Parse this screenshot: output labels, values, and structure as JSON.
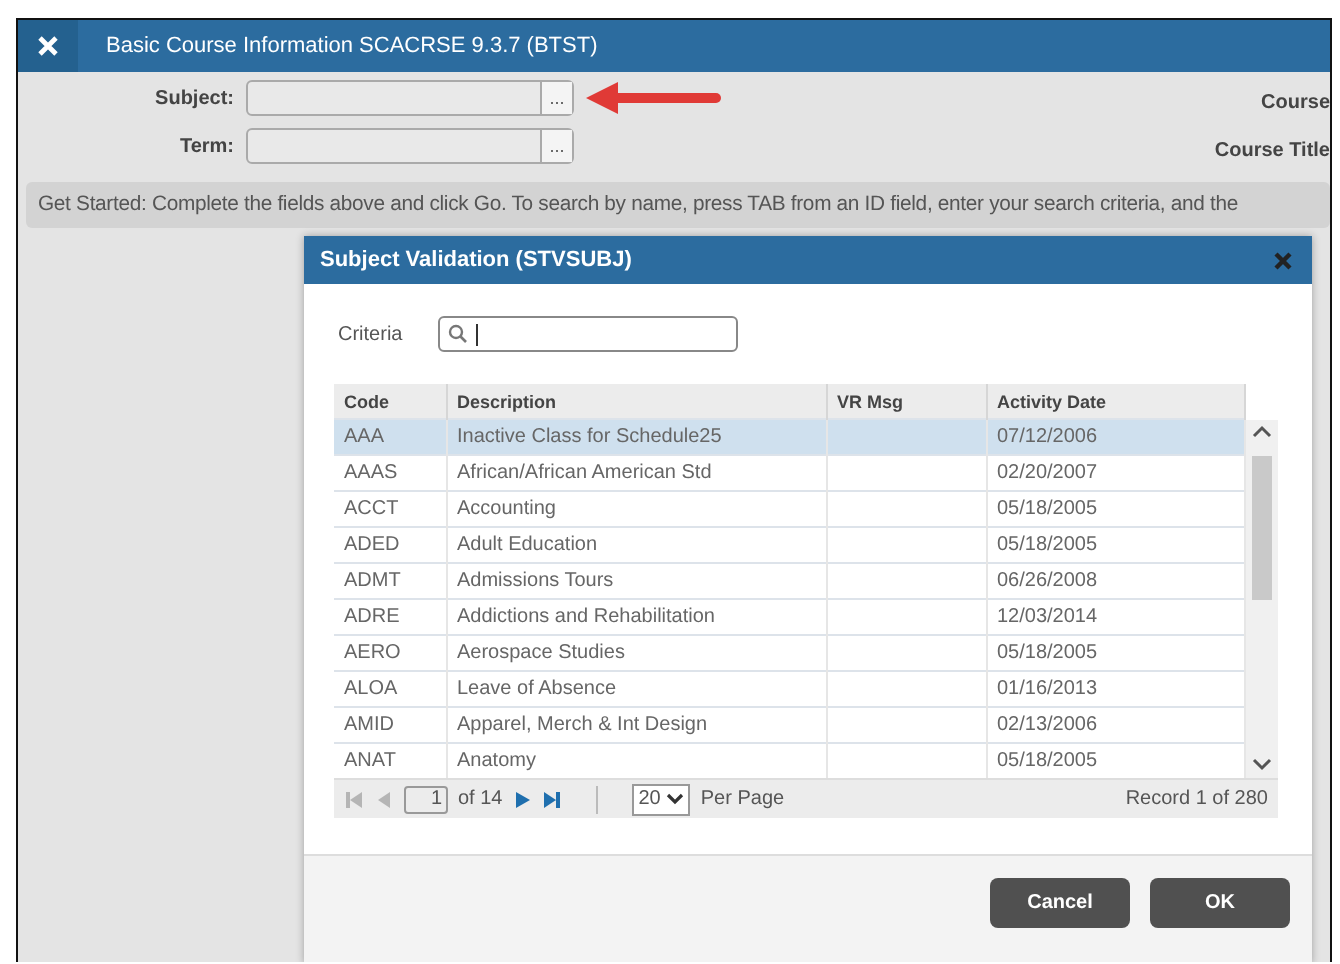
{
  "window": {
    "title": "Basic Course Information SCACRSE 9.3.7 (BTST)"
  },
  "fields": [
    {
      "label": "Subject:",
      "button": "..."
    },
    {
      "label": "Term:",
      "button": "..."
    }
  ],
  "right_labels": [
    "Course",
    "Course Title"
  ],
  "info": "Get Started: Complete the fields above and click Go. To search by name, press TAB from an ID field, enter your search criteria, and the",
  "dialog": {
    "title": "Subject Validation (STVSUBJ)",
    "criteria_label": "Criteria",
    "columns": [
      "Code",
      "Description",
      "VR Msg",
      "Activity Date"
    ],
    "rows": [
      {
        "code": "AAA",
        "description": "Inactive Class for Schedule25",
        "date": "07/12/2006",
        "selected": true
      },
      {
        "code": "AAAS",
        "description": "African/African American Std",
        "date": "02/20/2007",
        "selected": false
      },
      {
        "code": "ACCT",
        "description": "Accounting",
        "date": "05/18/2005",
        "selected": false
      },
      {
        "code": "ADED",
        "description": "Adult Education",
        "date": "05/18/2005",
        "selected": false
      },
      {
        "code": "ADMT",
        "description": "Admissions Tours",
        "date": "06/26/2008",
        "selected": false
      },
      {
        "code": "ADRE",
        "description": "Addictions and Rehabilitation",
        "date": "12/03/2014",
        "selected": false
      },
      {
        "code": "AERO",
        "description": "Aerospace Studies",
        "date": "05/18/2005",
        "selected": false
      },
      {
        "code": "ALOA",
        "description": "Leave of Absence",
        "date": "01/16/2013",
        "selected": false
      },
      {
        "code": "AMID",
        "description": "Apparel, Merch & Int Design",
        "date": "02/13/2006",
        "selected": false
      },
      {
        "code": "ANAT",
        "description": "Anatomy",
        "date": "05/18/2005",
        "selected": false
      }
    ],
    "pager": {
      "page": "1",
      "of": "of 14",
      "per_page": "20",
      "per_page_label": "Per Page",
      "record": "Record 1 of 280"
    },
    "buttons": [
      "Cancel",
      "OK"
    ]
  }
}
